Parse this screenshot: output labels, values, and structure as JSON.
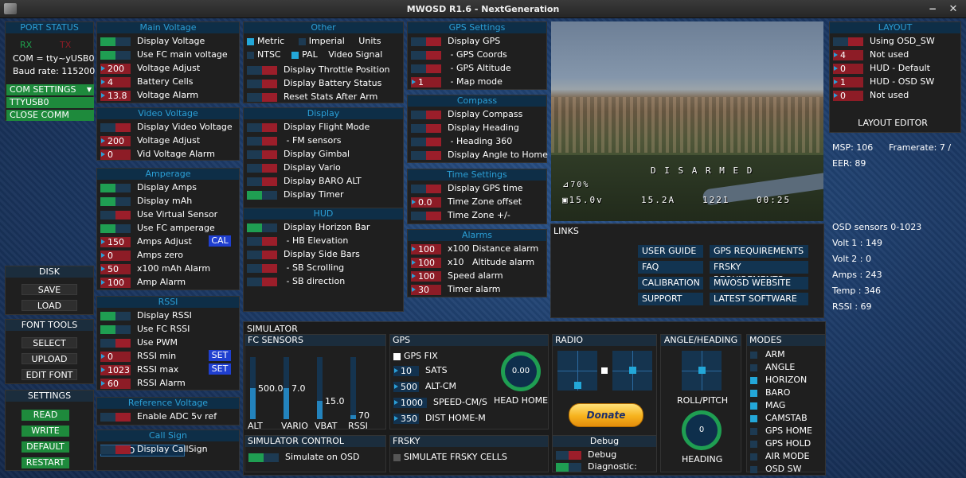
{
  "title": "MWOSD R1.6 - NextGeneration",
  "window": {
    "min": "−",
    "close": "✕"
  },
  "port_status": {
    "title": "PORT STATUS",
    "rx": "RX",
    "tx": "TX",
    "com": "COM = tty~yUSB0",
    "baud": "Baud rate: 115200",
    "com_settings": "COM SETTINGS",
    "port": "TTYUSB0",
    "close": "CLOSE COMM"
  },
  "disk": {
    "title": "DISK",
    "save": "SAVE",
    "load": "LOAD"
  },
  "font_tools": {
    "title": "FONT TOOLS",
    "select": "SELECT",
    "upload": "UPLOAD",
    "edit": "EDIT FONT"
  },
  "settings": {
    "title": "SETTINGS",
    "read": "READ",
    "write": "WRITE",
    "default": "DEFAULT",
    "restart": "RESTART"
  },
  "main_voltage": {
    "title": "Main Voltage",
    "rows": [
      {
        "k": "t",
        "s": "on",
        "label": "Display Voltage"
      },
      {
        "k": "t",
        "s": "on",
        "label": "Use FC main voltage"
      },
      {
        "k": "n",
        "v": "200",
        "label": "Voltage Adjust"
      },
      {
        "k": "n",
        "v": "4",
        "label": "Battery Cells"
      },
      {
        "k": "n",
        "v": "13.8",
        "label": "Voltage Alarm"
      }
    ]
  },
  "video_voltage": {
    "title": "Video Voltage",
    "rows": [
      {
        "k": "t",
        "s": "off",
        "label": "Display Video Voltage"
      },
      {
        "k": "n",
        "v": "200",
        "label": "Voltage Adjust"
      },
      {
        "k": "n",
        "v": "0",
        "label": "Vid Voltage Alarm"
      }
    ]
  },
  "amperage": {
    "title": "Amperage",
    "rows": [
      {
        "k": "t",
        "s": "on",
        "label": "Display Amps"
      },
      {
        "k": "t",
        "s": "on",
        "label": "Display mAh"
      },
      {
        "k": "t",
        "s": "off",
        "label": "Use Virtual Sensor"
      },
      {
        "k": "t",
        "s": "on",
        "label": "Use FC amperage"
      },
      {
        "k": "n",
        "v": "150",
        "label": "Amps Adjust"
      },
      {
        "k": "n",
        "v": "0",
        "label": "Amps zero"
      },
      {
        "k": "n",
        "v": "50",
        "label": "x100 mAh Alarm"
      },
      {
        "k": "n",
        "v": "100",
        "label": "Amp Alarm"
      }
    ],
    "cal": "CAL"
  },
  "rssi": {
    "title": "RSSI",
    "rows": [
      {
        "k": "t",
        "s": "on",
        "label": "Display RSSI"
      },
      {
        "k": "t",
        "s": "on",
        "label": "Use FC RSSI"
      },
      {
        "k": "t",
        "s": "off",
        "label": "Use PWM"
      },
      {
        "k": "n",
        "v": "0",
        "label": "RSSI min"
      },
      {
        "k": "n",
        "v": "1023",
        "label": "RSSI max"
      },
      {
        "k": "n",
        "v": "60",
        "label": "RSSI Alarm"
      }
    ],
    "set": "SET"
  },
  "ref_voltage": {
    "title": "Reference Voltage",
    "rows": [
      {
        "k": "t",
        "s": "off",
        "label": "Enable ADC 5v ref"
      }
    ]
  },
  "call_sign": {
    "title": "Call Sign",
    "rows": [
      {
        "k": "t",
        "s": "off",
        "label": "Display CallSign"
      }
    ],
    "value": "VERGO"
  },
  "other": {
    "title": "Other",
    "metric": "Metric",
    "imperial": "Imperial",
    "units": "Units",
    "ntsc": "NTSC",
    "pal": "PAL",
    "video_signal": "Video Signal",
    "rows": [
      {
        "k": "t",
        "s": "off",
        "label": "Display Throttle Position"
      },
      {
        "k": "t",
        "s": "off",
        "label": "Display Battery Status"
      },
      {
        "k": "t",
        "s": "off",
        "label": "Reset Stats After Arm"
      }
    ]
  },
  "display": {
    "title": "Display",
    "rows": [
      {
        "k": "t",
        "s": "off",
        "label": "Display Flight Mode"
      },
      {
        "k": "t",
        "s": "off",
        "label": " - FM sensors"
      },
      {
        "k": "t",
        "s": "off",
        "label": "Display Gimbal"
      },
      {
        "k": "t",
        "s": "off",
        "label": "Display Vario"
      },
      {
        "k": "t",
        "s": "off",
        "label": "Display BARO ALT"
      },
      {
        "k": "t",
        "s": "on",
        "label": "Display Timer"
      }
    ]
  },
  "hud": {
    "title": "HUD",
    "rows": [
      {
        "k": "t",
        "s": "on",
        "label": "Display Horizon Bar"
      },
      {
        "k": "t",
        "s": "off",
        "label": " - HB Elevation"
      },
      {
        "k": "t",
        "s": "off",
        "label": "Display Side Bars"
      },
      {
        "k": "t",
        "s": "off",
        "label": " - SB Scrolling"
      },
      {
        "k": "t",
        "s": "off",
        "label": " - SB direction"
      }
    ]
  },
  "gps_settings": {
    "title": "GPS Settings",
    "rows": [
      {
        "k": "t",
        "s": "off",
        "label": "Display GPS"
      },
      {
        "k": "t",
        "s": "off",
        "label": " - GPS Coords"
      },
      {
        "k": "t",
        "s": "off",
        "label": " - GPS Altitude"
      },
      {
        "k": "n",
        "v": "1",
        "label": " - Map mode"
      }
    ]
  },
  "compass": {
    "title": "Compass",
    "rows": [
      {
        "k": "t",
        "s": "off",
        "label": "Display Compass"
      },
      {
        "k": "t",
        "s": "off",
        "label": "Display Heading"
      },
      {
        "k": "t",
        "s": "off",
        "label": " - Heading 360"
      },
      {
        "k": "t",
        "s": "off",
        "label": "Display Angle to Home"
      }
    ]
  },
  "time_settings": {
    "title": "Time Settings",
    "rows": [
      {
        "k": "t",
        "s": "off",
        "label": "Display GPS time"
      },
      {
        "k": "n",
        "v": "0.0",
        "label": "Time Zone offset"
      },
      {
        "k": "t",
        "s": "off",
        "label": "Time Zone +/-"
      }
    ]
  },
  "alarms": {
    "title": "Alarms",
    "rows": [
      {
        "k": "n",
        "v": "100",
        "label": "x100 Distance alarm"
      },
      {
        "k": "n",
        "v": "100",
        "label": "x10   Altitude alarm"
      },
      {
        "k": "n",
        "v": "100",
        "label": "Speed alarm"
      },
      {
        "k": "n",
        "v": "30",
        "label": "Timer alarm"
      }
    ]
  },
  "osd_preview": {
    "disarmed": "D I S A R M E D",
    "rssi": "⊿70%",
    "batt": "▣15.0v",
    "amps": "15.2A",
    "mah": "1221",
    "timer": "00:25"
  },
  "links": {
    "title": "LINKS",
    "left": [
      "USER GUIDE",
      "FAQ",
      "CALIBRATION",
      "SUPPORT"
    ],
    "right": [
      "GPS REQUIREMENTS",
      "FRSKY REQUIREMENTS",
      "MWOSD WEBSITE",
      "LATEST SOFTWARE"
    ]
  },
  "layout": {
    "title": "LAYOUT",
    "rows": [
      {
        "k": "t",
        "s": "off",
        "label": "Using OSD_SW"
      },
      {
        "k": "n",
        "v": "4",
        "label": "Not used"
      },
      {
        "k": "n",
        "v": "0",
        "label": "HUD - Default"
      },
      {
        "k": "n",
        "v": "1",
        "label": "HUD - OSD SW"
      },
      {
        "k": "n",
        "v": "0",
        "label": "Not used"
      }
    ],
    "editor": "LAYOUT EDITOR"
  },
  "stats": {
    "msp": "MSP: 106",
    "framerate": "Framerate: 7 /",
    "eer": "EER: 89",
    "sensors": "OSD sensors 0-1023",
    "volt1": "Volt 1 : 149",
    "volt2": "Volt 2 : 0",
    "amps": "Amps  : 243",
    "temp": "Temp  : 346",
    "rssi": "RSSI  : 69"
  },
  "simulator": {
    "title": "SIMULATOR",
    "fc": {
      "title": "FC SENSORS",
      "bars": [
        {
          "label": "ALT",
          "value": "500.0",
          "level": 0.5
        },
        {
          "label": "VARIO",
          "value": "7.0",
          "level": 0.5
        },
        {
          "label": "VBAT",
          "value": "15.0",
          "level": 0.3
        },
        {
          "label": "RSSI",
          "value": "70",
          "level": 0.07
        }
      ]
    },
    "gps": {
      "title": "GPS",
      "fix": "GPS FIX",
      "rows": [
        {
          "v": "10",
          "label": "SATS"
        },
        {
          "v": "500",
          "label": "ALT-CM"
        },
        {
          "v": "1000",
          "label": "SPEED-CM/S"
        },
        {
          "v": "350",
          "label": "DIST HOME-M"
        }
      ],
      "head_value": "0.00",
      "head_label": "HEAD HOME"
    },
    "radio": {
      "title": "RADIO",
      "donate": "Donate"
    },
    "angle": {
      "title": "ANGLE/HEADING",
      "roll": "ROLL/PITCH",
      "heading_value": "0",
      "heading": "HEADING"
    },
    "modes": {
      "title": "MODES",
      "items": [
        {
          "label": "ARM",
          "on": false
        },
        {
          "label": "ANGLE",
          "on": false
        },
        {
          "label": "HORIZON",
          "on": true
        },
        {
          "label": "BARO",
          "on": true
        },
        {
          "label": "MAG",
          "on": true
        },
        {
          "label": "CAMSTAB",
          "on": true
        },
        {
          "label": "GPS HOME",
          "on": false
        },
        {
          "label": "GPS HOLD",
          "on": false
        },
        {
          "label": "AIR MODE",
          "on": false
        },
        {
          "label": "OSD SW",
          "on": false
        }
      ]
    },
    "control": {
      "title": "SIMULATOR CONTROL",
      "label": "Simulate on OSD"
    },
    "frsky": {
      "title": "FRSKY",
      "label": "SIMULATE FRSKY CELLS"
    },
    "debug": {
      "title": "Debug",
      "debug": "Debug",
      "diag": "Diagnostic:"
    }
  },
  "colors": {
    "accent": "#2b9fd6",
    "green": "#1e8a3c",
    "red": "#8d1c26"
  }
}
